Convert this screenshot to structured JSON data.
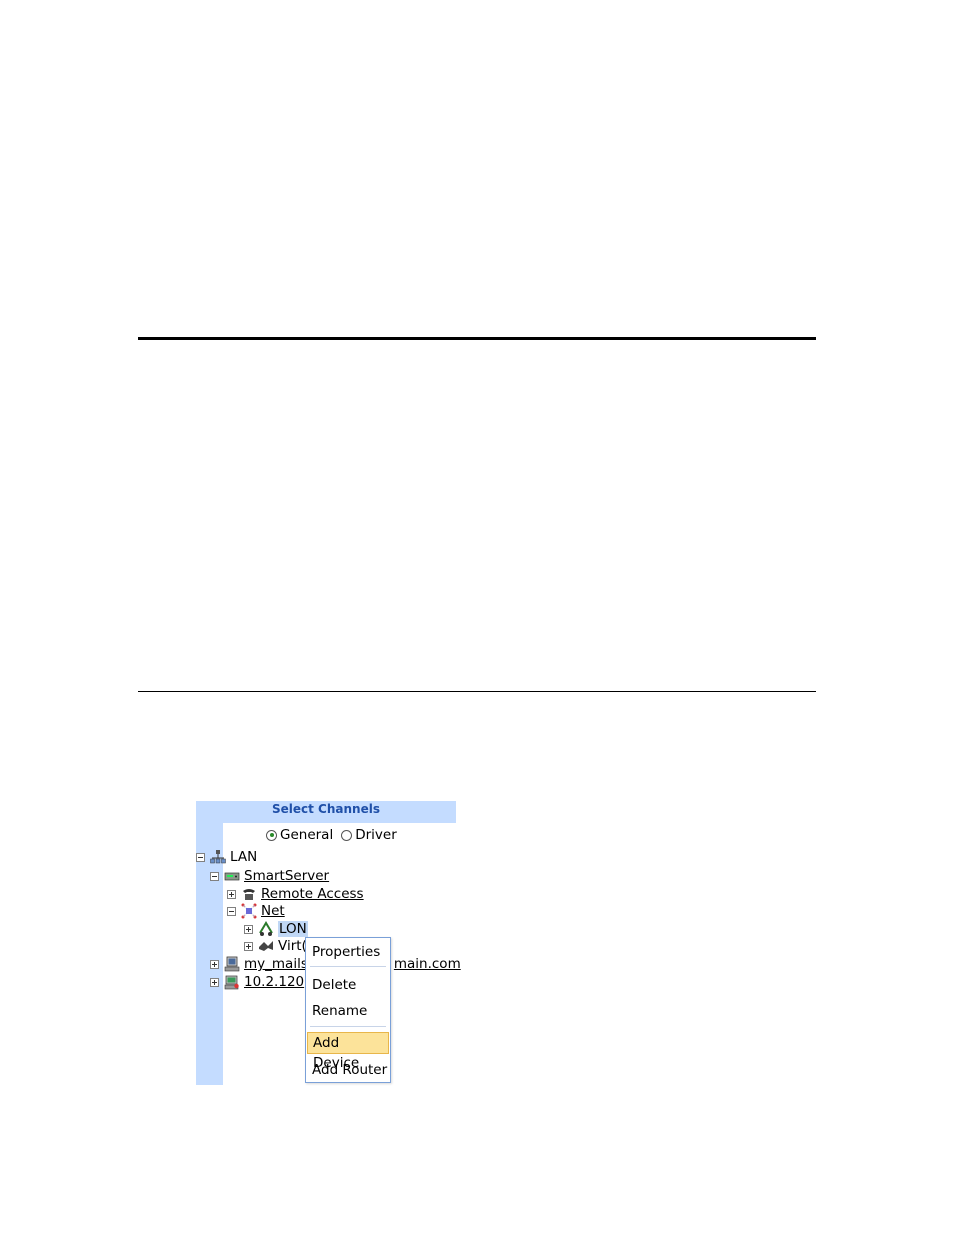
{
  "panel": {
    "title": "Select Channels",
    "radio_general": "General",
    "radio_driver": "Driver",
    "selected_mode": "General"
  },
  "tree": {
    "lan": "LAN",
    "smartserver": "SmartServer",
    "remote_access": "Remote Access",
    "net": "Net",
    "lon": "LON",
    "virt": "Virt(",
    "mail_a": "my_mails",
    "mail_b": "main.com",
    "ip": "10.2.120"
  },
  "context_menu": {
    "items": [
      "Properties",
      "Delete",
      "Rename",
      "Add Device",
      "Add Router"
    ],
    "highlighted": "Add Device"
  },
  "icons": {
    "lan": "network-icon",
    "smartserver": "server-icon",
    "remote_access": "telephone-icon",
    "net": "network-node-icon",
    "lon": "lon-channel-icon",
    "virt": "virtual-channel-icon",
    "mail": "computer-icon",
    "ip": "remote-computer-icon"
  },
  "colors": {
    "panel_header_bg": "#c4dcff",
    "panel_header_text": "#2050a8",
    "highlight_bg": "#fce39a",
    "selection_bg": "#c0d7f5"
  }
}
